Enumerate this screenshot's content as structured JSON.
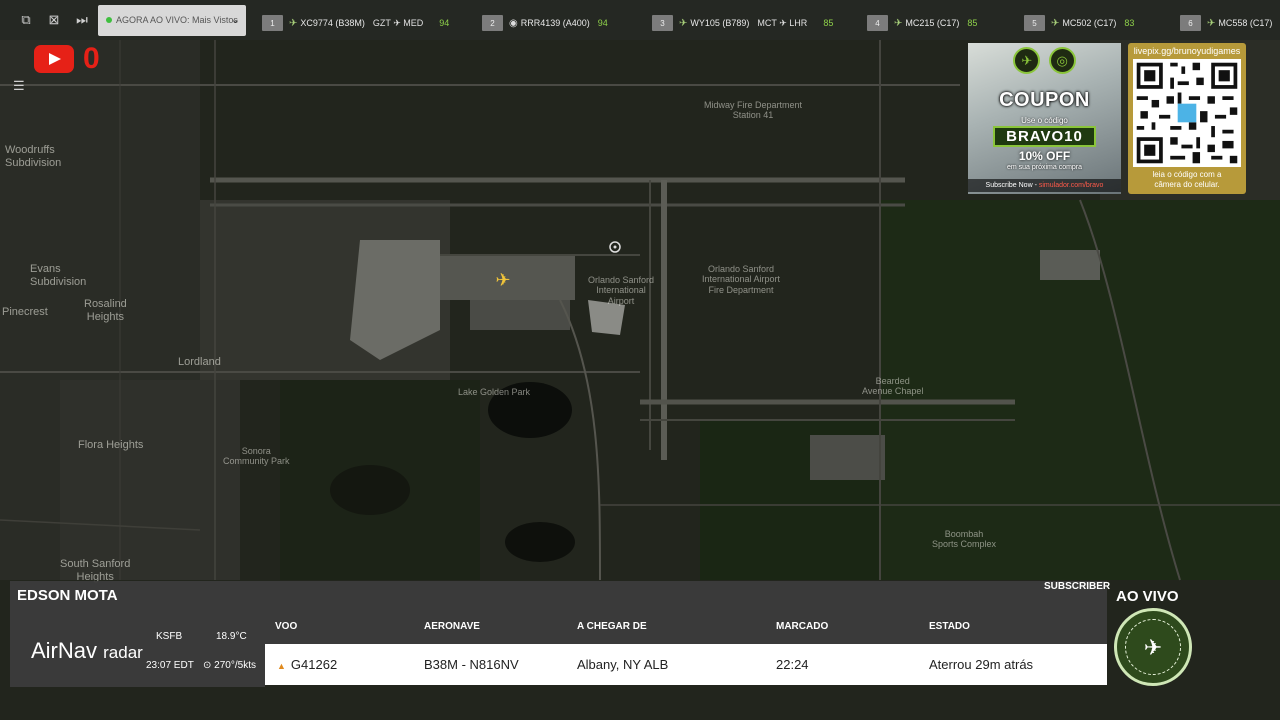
{
  "top_bar": {
    "now_live_label": "AGORA AO VIVO: Mais Vistos",
    "flights": [
      {
        "rank": "1",
        "callsign": "XC9774 (B38M)",
        "route": "GZT ✈ MED",
        "score": "94"
      },
      {
        "rank": "2",
        "callsign": "RRR4139 (A400)",
        "route": "",
        "score": "94"
      },
      {
        "rank": "3",
        "callsign": "WY105 (B789)",
        "route": "MCT ✈ LHR",
        "score": "85"
      },
      {
        "rank": "4",
        "callsign": "MC215 (C17)",
        "route": "",
        "score": "85"
      },
      {
        "rank": "5",
        "callsign": "MC502 (C17)",
        "route": "",
        "score": "83"
      },
      {
        "rank": "6",
        "callsign": "MC558 (C17)",
        "route": "",
        "score": ""
      }
    ]
  },
  "youtube": {
    "count": "0"
  },
  "map": {
    "labels": {
      "woodruffs": "Woodruffs\nSubdivision",
      "evans": "Evans\nSubdivision",
      "pinecrest": "Pinecrest",
      "rosalind": "Rosalind\nHeights",
      "lordland": "Lordland",
      "flora": "Flora Heights",
      "south_sanford": "South Sanford\nHeights",
      "midway_fire": "Midway Fire Department\nStation 41",
      "orlando_fire": "Orlando Sanford\nInternational Airport\nFire Department",
      "airport": "Orlando Sanford\nInternational\nAirport",
      "lake_golden": "Lake Golden Park",
      "bearded_chapel": "Bearded\nAvenue Chapel",
      "sonora": "Sonora\nCommunity Park",
      "boombah": "Boombah\nSports Complex"
    }
  },
  "coupon": {
    "title": "COUPON",
    "subtitle": "Use o código",
    "code": "BRAVO10",
    "discount": "10% OFF",
    "fine_print": "em sua próxima compra",
    "subscribe_prefix": "Subscribe Now -",
    "subscribe_link": "simulador.com/bravo"
  },
  "qr": {
    "url": "livepix.gg/brunoyudigames",
    "caption": "leia o código com a\ncâmera do celular."
  },
  "bottom": {
    "streamer_name": "EDSON MOTA",
    "subscriber_label": "SUBSCRIBER",
    "live_label": "AO VIVO",
    "airnav_logo": "AirNav",
    "airnav_logo_sub": "radar",
    "airport": "KSFB",
    "temperature": "18.9°C",
    "local_time": "23:07 EDT",
    "wind": "270°/5kts",
    "columns": {
      "flight": "VOO",
      "aircraft": "AERONAVE",
      "from": "A CHEGAR DE",
      "scheduled": "MARCADO",
      "status": "ESTADO"
    },
    "row": {
      "flight": "G41262",
      "aircraft": "B38M - N816NV",
      "from": "Albany, NY ALB",
      "scheduled": "22:24",
      "status": "Aterrou 29m atrás"
    }
  }
}
